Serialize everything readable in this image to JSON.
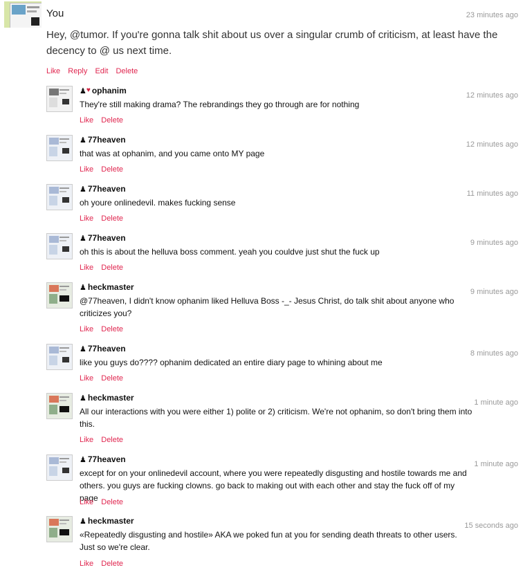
{
  "post": {
    "author": "You",
    "time": "23 minutes ago",
    "text": "Hey, @tumor. If you're gonna talk shit about us over a singular crumb of criticism, at least have the decency to @ us next time.",
    "actions": [
      "Like",
      "Reply",
      "Edit",
      "Delete"
    ]
  },
  "replies": [
    {
      "user": "ophanim",
      "time": "12 minutes ago",
      "text": "They're still making drama? The rebrandings they go through are for nothing",
      "actions": [
        "Like",
        "Delete"
      ]
    },
    {
      "user": "77heaven",
      "time": "12 minutes ago",
      "text": "that was at ophanim, and you came onto MY page",
      "actions": [
        "Like",
        "Delete"
      ]
    },
    {
      "user": "77heaven",
      "time": "11 minutes ago",
      "text": "oh youre onlinedevil. makes fucking sense",
      "actions": [
        "Like",
        "Delete"
      ]
    },
    {
      "user": "77heaven",
      "time": "9 minutes ago",
      "text": "oh this is about the helluva boss comment. yeah you couldve just shut the fuck up",
      "actions": [
        "Like",
        "Delete"
      ]
    },
    {
      "user": "heckmaster",
      "time": "9 minutes ago",
      "text": "@77heaven, I didn't know ophanim liked Helluva Boss -_- Jesus Christ, do talk shit about anyone who criticizes you?",
      "actions": [
        "Like",
        "Delete"
      ]
    },
    {
      "user": "77heaven",
      "time": "8 minutes ago",
      "text": "like you guys do???? ophanim dedicated an entire diary page to whining about me",
      "actions": [
        "Like",
        "Delete"
      ]
    },
    {
      "user": "heckmaster",
      "time": "1 minute ago",
      "text": "All our interactions with you were either 1) polite or 2) criticism. We're not ophanim, so don't bring them into this.",
      "actions": [
        "Like",
        "Delete"
      ]
    },
    {
      "user": "77heaven",
      "time": "1 minute ago",
      "text": "except for on your onlinedevil account, where you were repeatedly disgusting and hostile towards me and others. you guys are fucking clowns. go back to making out with each other and stay the fuck off of my page",
      "actions": [
        "Like",
        "Delete"
      ]
    },
    {
      "user": "heckmaster",
      "time": "15 seconds ago",
      "text": "«Repeatedly disgusting and hostile» AKA we poked fun at you for sending death threats to other users. Just so we're clear.",
      "actions": [
        "Like",
        "Delete"
      ]
    }
  ],
  "colors": {
    "action_link": "#e0264f",
    "timestamp": "#999999",
    "supporter_heart": "#d0213f"
  },
  "icons": {
    "person": "person-icon",
    "heart": "heart-icon"
  }
}
